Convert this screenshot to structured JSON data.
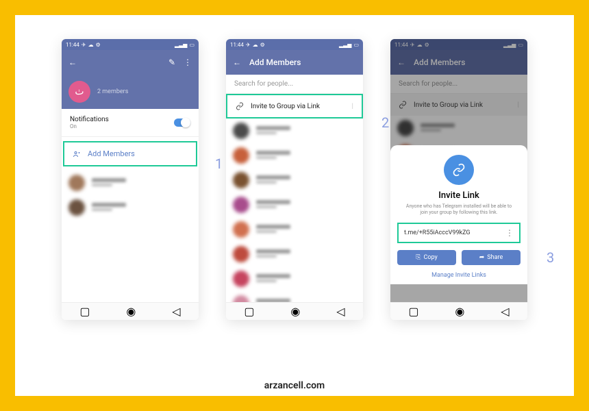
{
  "footer": "arzancell.com",
  "status_time": "11:44",
  "phone1": {
    "members": "2 members",
    "notifications": {
      "label": "Notifications",
      "value": "On"
    },
    "add_members": "Add Members"
  },
  "phone2": {
    "title": "Add Members",
    "search_placeholder": "Search for people...",
    "invite_via_link": "Invite to Group via Link"
  },
  "phone3": {
    "title": "Add Members",
    "search_placeholder": "Search for people...",
    "invite_via_link": "Invite to Group via Link",
    "sheet": {
      "title": "Invite Link",
      "desc": "Anyone who has Telegram installed will be able to join your group by following this link.",
      "link": "t.me/+R55iAcccV99kZG",
      "copy": "Copy",
      "share": "Share",
      "manage": "Manage Invite Links"
    }
  },
  "steps": {
    "s1": "1",
    "s2": "2",
    "s3": "3"
  },
  "colors": {
    "primary": "#6372aa",
    "accent": "#1ec997",
    "frame": "#f9be00",
    "blue_btn": "#5b7fc7"
  },
  "contact_colors_p1": [
    "#a0785b",
    "#6b5240"
  ],
  "contact_colors_p2": [
    "#4b4b4b",
    "#c7603b",
    "#7a5230",
    "#a84c8c",
    "#d1704f",
    "#be4b3d",
    "#c6445f",
    "#d28aa0",
    "#a64fa0",
    "#326d98"
  ],
  "contact_colors_p3": [
    "#4b4b4b",
    "#c7603b"
  ]
}
